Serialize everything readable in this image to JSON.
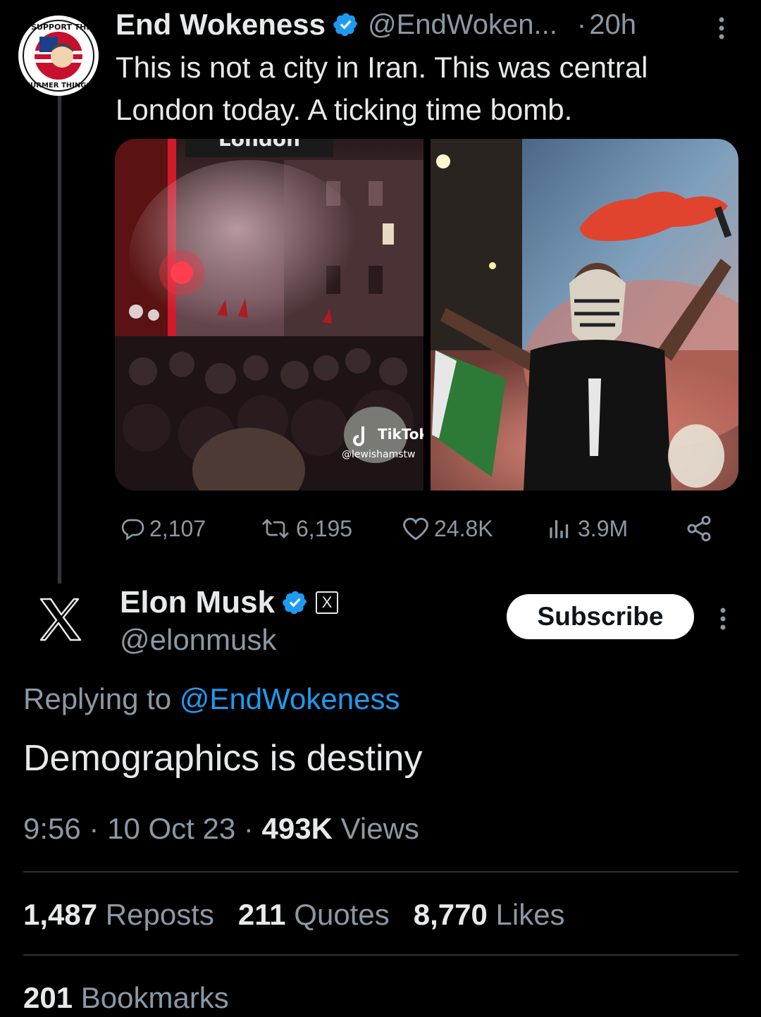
{
  "post1": {
    "name": "End Wokeness",
    "handle": "@EndWoken...",
    "dot": "·",
    "time": "20h",
    "text": "This is not a city in Iran. This was central London today. A ticking time bomb.",
    "media_left": {
      "sign_text": "London",
      "watermark_brand": "TikTok",
      "watermark_user": "@lewishamstw"
    },
    "avatar_text_top": "I SUPPORT THE",
    "avatar_text_bottom": "FURMER THINGS",
    "actions": {
      "replies": "2,107",
      "reposts": "6,195",
      "likes": "24.8K",
      "views": "3.9M"
    }
  },
  "post2": {
    "name": "Elon Musk",
    "badge": "X",
    "handle": "@elonmusk",
    "subscribe_label": "Subscribe",
    "replying_prefix": "Replying to",
    "replying_to": "@EndWokeness",
    "text": "Demographics is destiny",
    "meta": {
      "time": "9:56",
      "sep1": "·",
      "date": "10 Oct 23",
      "sep2": "·",
      "views_count": "493K",
      "views_label": "Views"
    },
    "stats": {
      "reposts_count": "1,487",
      "reposts_label": "Reposts",
      "quotes_count": "211",
      "quotes_label": "Quotes",
      "likes_count": "8,770",
      "likes_label": "Likes",
      "bookmarks_count": "201",
      "bookmarks_label": "Bookmarks"
    }
  },
  "colors": {
    "background": "#000000",
    "text": "#e7e9ea",
    "secondary": "#8b98a5",
    "link": "#1d9bf0",
    "verified": "#1d9bf0"
  }
}
